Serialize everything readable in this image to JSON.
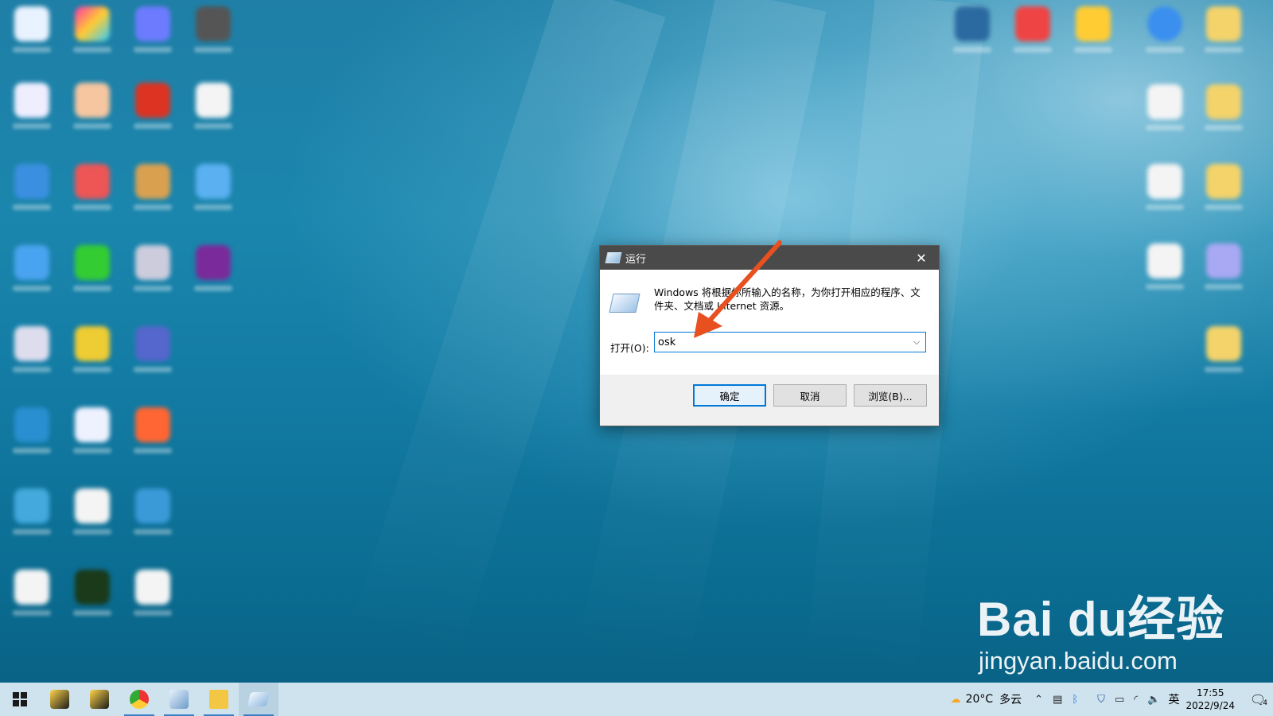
{
  "dialog": {
    "title": "运行",
    "description": "Windows 将根据你所输入的名称，为你打开相应的程序、文件夹、文档或 Internet 资源。",
    "open_label": "打开(O):",
    "input_value": "osk",
    "ok_label": "确定",
    "cancel_label": "取消",
    "browse_label": "浏览(B)...",
    "close_glyph": "✕",
    "dropdown_glyph": "⌵"
  },
  "watermark": {
    "brand": "Bai du经验",
    "site": "jingyan.baidu.com"
  },
  "taskbar": {
    "weather_temp": "20°C",
    "weather_desc": "多云",
    "ime": "英",
    "time": "17:55",
    "date": "2022/9/24",
    "notification_count": "4"
  },
  "colors": {
    "accent": "#0078d7",
    "arrow": "#e8501f",
    "titlebar": "#4a4a4a"
  },
  "icons": [
    "windows-start-icon",
    "weather-icon",
    "tray-chevron-icon",
    "network-icon",
    "bluetooth-icon",
    "shield-icon",
    "battery-icon",
    "wifi-icon",
    "volume-icon",
    "notification-icon"
  ]
}
